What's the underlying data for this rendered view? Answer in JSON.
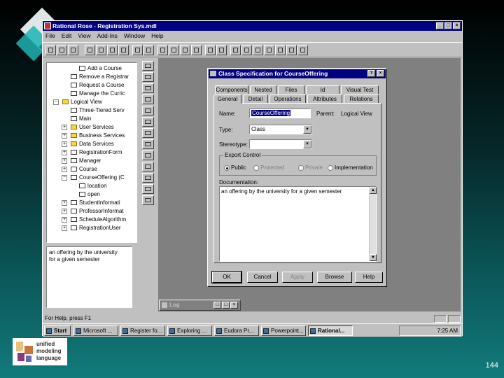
{
  "window": {
    "title": "Rational Rose - Registration Sys.mdl"
  },
  "menu": [
    "File",
    "Edit",
    "View",
    "Add-Ins",
    "Window",
    "Help"
  ],
  "browser": {
    "items": [
      "Add a Course",
      "Remove a Registrar",
      "Request a Course",
      "Manage the Curric",
      "Logical View",
      "Three-Tiered Serv",
      "Main",
      "User Services",
      "Business Services",
      "Data Services",
      "RegistrationForm",
      "Manager",
      "Course",
      "CourseOffering (C",
      "location",
      "open",
      "StudentInformati",
      "ProfessorInformat",
      "ScheduleAlgorithm",
      "RegistrationUser"
    ]
  },
  "documentation_pane": {
    "text": "an offering by the university for a given semester"
  },
  "log": {
    "title": "Log"
  },
  "status": {
    "text": "For Help, press F1"
  },
  "dialog": {
    "title": "Class Specification for CourseOffering",
    "tabs_back": [
      "Components",
      "Nested",
      "Files",
      "Id",
      "Visual Test"
    ],
    "tabs_front": [
      "General",
      "Detail",
      "Operations",
      "Attributes",
      "Relations"
    ],
    "name_label": "Name:",
    "name_value": "CourseOffering",
    "parent_label": "Parent:",
    "parent_value": "Logical View",
    "type_label": "Type:",
    "type_value": "Class",
    "stereotype_label": "Stereotype:",
    "stereotype_value": "",
    "export_label": "Export Control",
    "radios": [
      "Public",
      "Protected",
      "Private",
      "Implementation"
    ],
    "doc_label": "Documentation:",
    "doc_value": "an offering by the university for a given semester",
    "buttons": [
      "OK",
      "Cancel",
      "Apply",
      "Browse",
      "Help"
    ]
  },
  "taskbar": {
    "items": [
      "Start",
      "Microsoft ...",
      "Register fo...",
      "Exploring ...",
      "Eudora Pr...",
      "Powerpoint...",
      "Rational..."
    ],
    "clock": "7:25 AM"
  },
  "logo": {
    "text": "unified modeling language"
  },
  "slide": {
    "page_number": "144"
  }
}
